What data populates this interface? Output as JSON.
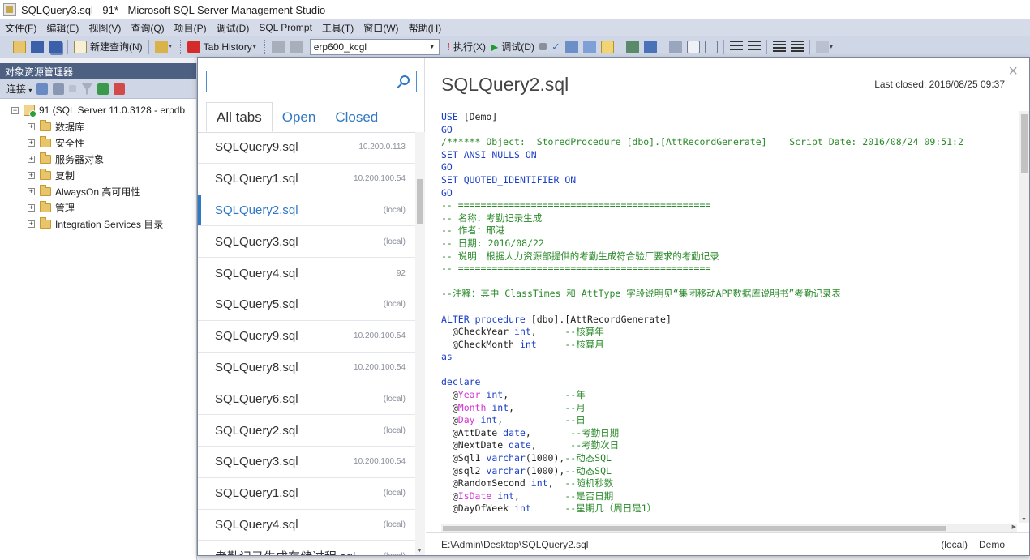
{
  "window": {
    "title": "SQLQuery3.sql - 91* - Microsoft SQL Server Management Studio"
  },
  "menu": [
    "文件(F)",
    "编辑(E)",
    "视图(V)",
    "查询(Q)",
    "项目(P)",
    "调试(D)",
    "SQL Prompt",
    "工具(T)",
    "窗口(W)",
    "帮助(H)"
  ],
  "toolbar": {
    "new_query": "新建查询(N)",
    "tab_history": "Tab History",
    "database": "erp600_kcgl",
    "execute": "执行(X)",
    "debug": "调试(D)"
  },
  "object_explorer": {
    "title": "对象资源管理器",
    "connect": "连接",
    "server": "91 (SQL Server 11.0.3128 - erpdb",
    "nodes": [
      "数据库",
      "安全性",
      "服务器对象",
      "复制",
      "AlwaysOn 高可用性",
      "管理",
      "Integration Services 目录"
    ]
  },
  "tab_history": {
    "search_placeholder": "",
    "tabs": [
      "All tabs",
      "Open",
      "Closed"
    ],
    "active_tab": "All tabs",
    "items": [
      {
        "name": "SQLQuery9.sql",
        "server": "10.200.0.113"
      },
      {
        "name": "SQLQuery1.sql",
        "server": "10.200.100.54"
      },
      {
        "name": "SQLQuery2.sql",
        "server": "(local)",
        "selected": true
      },
      {
        "name": "SQLQuery3.sql",
        "server": "(local)"
      },
      {
        "name": "SQLQuery4.sql",
        "server": "92"
      },
      {
        "name": "SQLQuery5.sql",
        "server": "(local)"
      },
      {
        "name": "SQLQuery9.sql",
        "server": "10.200.100.54"
      },
      {
        "name": "SQLQuery8.sql",
        "server": "10.200.100.54"
      },
      {
        "name": "SQLQuery6.sql",
        "server": "(local)"
      },
      {
        "name": "SQLQuery2.sql",
        "server": "(local)"
      },
      {
        "name": "SQLQuery3.sql",
        "server": "10.200.100.54"
      },
      {
        "name": "SQLQuery1.sql",
        "server": "(local)"
      },
      {
        "name": "SQLQuery4.sql",
        "server": "(local)"
      },
      {
        "name": "考勤记录生成存储过程.sql",
        "server": "(local)"
      }
    ]
  },
  "preview": {
    "title": "SQLQuery2.sql",
    "last_closed": "Last closed: 2016/08/25 09:37",
    "path": "E:\\Admin\\Desktop\\SQLQuery2.sql",
    "server": "(local)",
    "database": "Demo",
    "code": [
      [
        [
          "k",
          "USE "
        ],
        [
          "n",
          "[Demo]"
        ]
      ],
      [
        [
          "k",
          "GO"
        ]
      ],
      [
        [
          "c",
          "/****** Object:  StoredProcedure [dbo].[AttRecordGenerate]    Script Date: 2016/08/24 09:51:2"
        ]
      ],
      [
        [
          "k",
          "SET "
        ],
        [
          "k",
          "ANSI_NULLS "
        ],
        [
          "k",
          "ON"
        ]
      ],
      [
        [
          "k",
          "GO"
        ]
      ],
      [
        [
          "k",
          "SET "
        ],
        [
          "k",
          "QUOTED_IDENTIFIER "
        ],
        [
          "k",
          "ON"
        ]
      ],
      [
        [
          "k",
          "GO"
        ]
      ],
      [
        [
          "c",
          "-- ============================================="
        ]
      ],
      [
        [
          "c",
          "-- 名称：考勤记录生成"
        ]
      ],
      [
        [
          "c",
          "-- 作者：邢港"
        ]
      ],
      [
        [
          "c",
          "-- 日期: 2016/08/22"
        ]
      ],
      [
        [
          "c",
          "-- 说明：根据人力资源部提供的考勤生成符合验厂要求的考勤记录"
        ]
      ],
      [
        [
          "c",
          "-- ============================================="
        ]
      ],
      [],
      [
        [
          "c",
          "--注释：其中 ClassTimes 和 AttType 字段说明见“集团移动APP数据库说明书”考勤记录表"
        ]
      ],
      [],
      [
        [
          "k",
          "ALTER "
        ],
        [
          "k",
          "procedure "
        ],
        [
          "n",
          "[dbo].[AttRecordGenerate]"
        ]
      ],
      [
        [
          "n",
          "  @CheckYear "
        ],
        [
          "k",
          "int"
        ],
        [
          "n",
          ",     "
        ],
        [
          "c",
          "--核算年"
        ]
      ],
      [
        [
          "n",
          "  @CheckMonth "
        ],
        [
          "k",
          "int"
        ],
        [
          "n",
          "     "
        ],
        [
          "c",
          "--核算月"
        ]
      ],
      [
        [
          "k",
          "as"
        ]
      ],
      [],
      [
        [
          "k",
          "declare"
        ]
      ],
      [
        [
          "n",
          "  @"
        ],
        [
          "p",
          "Year"
        ],
        [
          "n",
          " "
        ],
        [
          "k",
          "int"
        ],
        [
          "n",
          ",          "
        ],
        [
          "c",
          "--年"
        ]
      ],
      [
        [
          "n",
          "  @"
        ],
        [
          "p",
          "Month"
        ],
        [
          "n",
          " "
        ],
        [
          "k",
          "int"
        ],
        [
          "n",
          ",         "
        ],
        [
          "c",
          "--月"
        ]
      ],
      [
        [
          "n",
          "  @"
        ],
        [
          "p",
          "Day"
        ],
        [
          "n",
          " "
        ],
        [
          "k",
          "int"
        ],
        [
          "n",
          ",           "
        ],
        [
          "c",
          "--日"
        ]
      ],
      [
        [
          "n",
          "  @AttDate "
        ],
        [
          "k",
          "date"
        ],
        [
          "n",
          ",       "
        ],
        [
          "c",
          "--考勤日期"
        ]
      ],
      [
        [
          "n",
          "  @NextDate "
        ],
        [
          "k",
          "date"
        ],
        [
          "n",
          ",      "
        ],
        [
          "c",
          "--考勤次日"
        ]
      ],
      [
        [
          "n",
          "  @Sql1 "
        ],
        [
          "k",
          "varchar"
        ],
        [
          "n",
          "(1000),"
        ],
        [
          "c",
          "--动态SQL"
        ]
      ],
      [
        [
          "n",
          "  @sql2 "
        ],
        [
          "k",
          "varchar"
        ],
        [
          "n",
          "(1000),"
        ],
        [
          "c",
          "--动态SQL"
        ]
      ],
      [
        [
          "n",
          "  @RandomSecond "
        ],
        [
          "k",
          "int"
        ],
        [
          "n",
          ",  "
        ],
        [
          "c",
          "--随机秒数"
        ]
      ],
      [
        [
          "n",
          "  @"
        ],
        [
          "p",
          "IsDate"
        ],
        [
          "n",
          " "
        ],
        [
          "k",
          "int"
        ],
        [
          "n",
          ",        "
        ],
        [
          "c",
          "--是否日期"
        ]
      ],
      [
        [
          "n",
          "  @DayOfWeek "
        ],
        [
          "k",
          "int"
        ],
        [
          "n",
          "      "
        ],
        [
          "c",
          "--星期几（周日是1）"
        ]
      ]
    ]
  },
  "colors": {
    "accent": "#2f78c4",
    "keyword": "#1a3fc7",
    "comment": "#2a8a2a",
    "builtin": "#d633d6"
  }
}
